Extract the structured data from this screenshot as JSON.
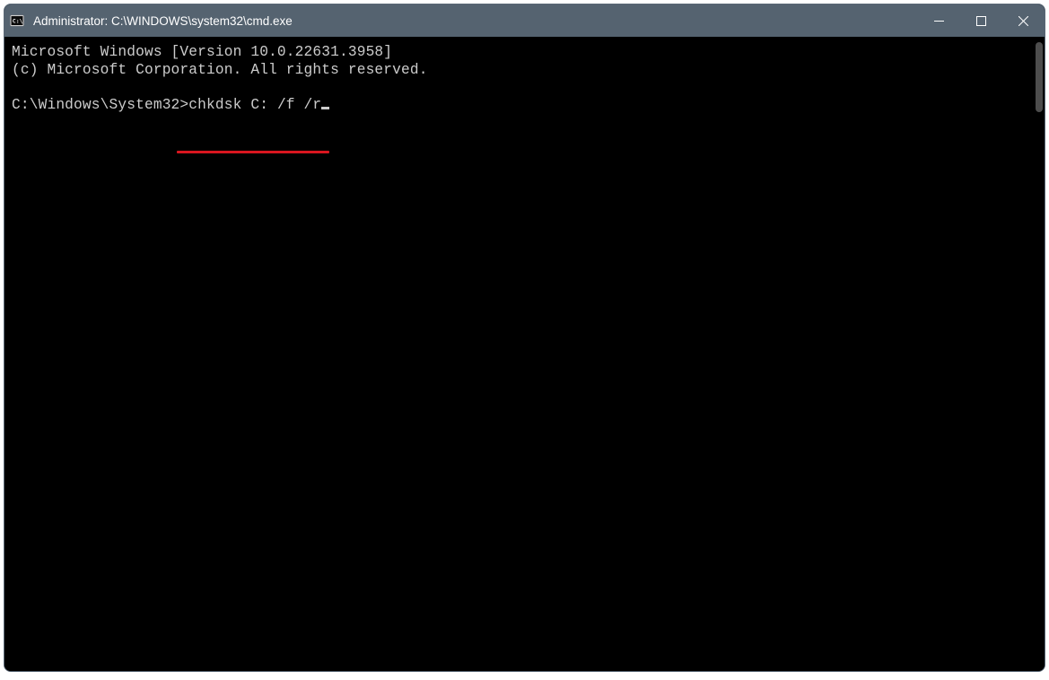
{
  "window": {
    "title": "Administrator: C:\\WINDOWS\\system32\\cmd.exe"
  },
  "terminal": {
    "line1": "Microsoft Windows [Version 10.0.22631.3958]",
    "line2": "(c) Microsoft Corporation. All rights reserved.",
    "prompt": "C:\\Windows\\System32>",
    "command": "chkdsk C: /f /r"
  }
}
